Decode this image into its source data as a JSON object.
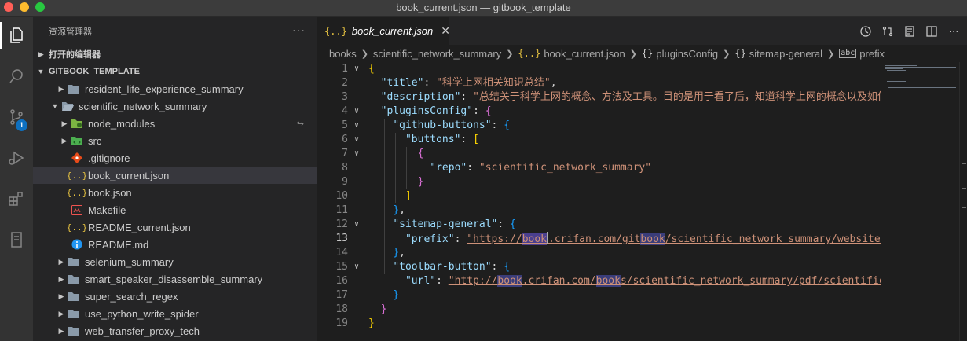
{
  "window": {
    "title": "book_current.json — gitbook_template"
  },
  "activity": {
    "scm_badge": "1"
  },
  "sidebar": {
    "header": "资源管理器",
    "more": "···",
    "open_editors": "打开的编辑器",
    "root": "GITBOOK_TEMPLATE",
    "tree": [
      {
        "label": "resident_life_experience_summary",
        "type": "folder",
        "depth": 1,
        "expanded": false
      },
      {
        "label": "scientific_network_summary",
        "type": "folder",
        "depth": 1,
        "expanded": true
      },
      {
        "label": "node_modules",
        "type": "folder-green",
        "depth": 2,
        "expanded": false
      },
      {
        "label": "src",
        "type": "folder-green",
        "depth": 2,
        "expanded": false
      },
      {
        "label": ".gitignore",
        "type": "git",
        "depth": 2
      },
      {
        "label": "book_current.json",
        "type": "json",
        "depth": 2,
        "selected": true
      },
      {
        "label": "book.json",
        "type": "json",
        "depth": 2
      },
      {
        "label": "Makefile",
        "type": "make",
        "depth": 2
      },
      {
        "label": "README_current.json",
        "type": "json",
        "depth": 2
      },
      {
        "label": "README.md",
        "type": "info",
        "depth": 2
      },
      {
        "label": "selenium_summary",
        "type": "folder",
        "depth": 1,
        "expanded": false
      },
      {
        "label": "smart_speaker_disassemble_summary",
        "type": "folder",
        "depth": 1,
        "expanded": false
      },
      {
        "label": "super_search_regex",
        "type": "folder",
        "depth": 1,
        "expanded": false
      },
      {
        "label": "use_python_write_spider",
        "type": "folder",
        "depth": 1,
        "expanded": false
      },
      {
        "label": "web_transfer_proxy_tech",
        "type": "folder",
        "depth": 1,
        "expanded": false
      }
    ]
  },
  "editor": {
    "tab": {
      "icon": "{..}",
      "label": "book_current.json",
      "close": "✕"
    },
    "breadcrumbs": [
      "books",
      "scientific_network_summary",
      "book_current.json",
      "pluginsConfig",
      "sitemap-general",
      "prefix"
    ],
    "line_numbers": [
      "1",
      "2",
      "3",
      "4",
      "5",
      "6",
      "7",
      "8",
      "9",
      "10",
      "11",
      "12",
      "13",
      "14",
      "15",
      "16",
      "17",
      "18",
      "19"
    ],
    "code": {
      "title_key": "\"title\"",
      "title_val": "\"科学上网相关知识总结\"",
      "desc_key": "\"description\"",
      "desc_val": "\"总结关于科学上网的概念、方法及工具。目的是用于看了后，知道科学上网的概念以及如何使用合适",
      "plugins_key": "\"pluginsConfig\"",
      "github_key": "\"github-buttons\"",
      "buttons_key": "\"buttons\"",
      "repo_key": "\"repo\"",
      "repo_val": "\"scientific_network_summary\"",
      "sitemap_key": "\"sitemap-general\"",
      "prefix_key": "\"prefix\"",
      "prefix_a": "\"https://",
      "prefix_b": "book",
      "prefix_c": ".crifan.com/git",
      "prefix_d": "book",
      "prefix_e": "/scientific_network_summary/website/\"",
      "toolbar_key": "\"toolbar-button\"",
      "url_key": "\"url\"",
      "url_a": "\"http://",
      "url_b": "book",
      "url_c": ".crifan.com/",
      "url_d": "book",
      "url_e": "s/scientific_network_summary/pdf/scientific_netwo"
    }
  }
}
